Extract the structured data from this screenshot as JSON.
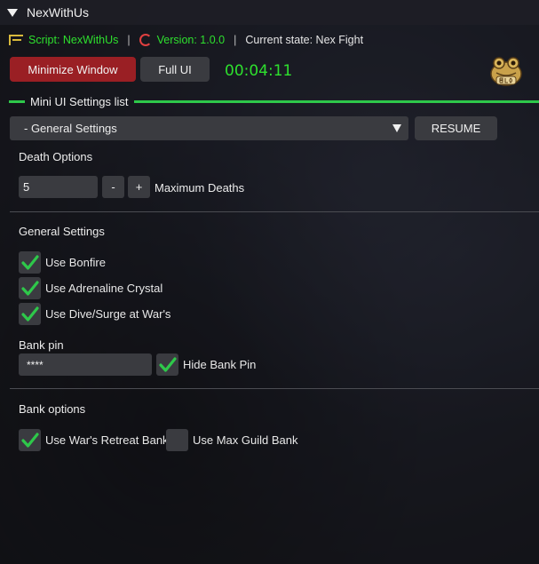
{
  "window": {
    "title": "NexWithUs"
  },
  "info": {
    "script_label": "Script: NexWithUs",
    "version_label": "Version: 1.0.0",
    "state_label": "Current state: Nex Fight",
    "separator": "|"
  },
  "buttons": {
    "minimize": "Minimize Window",
    "full_ui": "Full UI",
    "resume": "RESUME"
  },
  "timer": "00:04:11",
  "section": {
    "title": "Mini UI Settings list"
  },
  "dropdown": {
    "selected": "- General Settings"
  },
  "death_options": {
    "heading": "Death Options",
    "value": "5",
    "minus": "-",
    "plus": "+",
    "label": "Maximum Deaths"
  },
  "general_settings": {
    "heading": "General Settings",
    "items": [
      {
        "label": "Use Bonfire",
        "checked": true
      },
      {
        "label": "Use Adrenaline Crystal",
        "checked": true
      },
      {
        "label": "Use Dive/Surge at War's",
        "checked": true
      }
    ]
  },
  "bank_pin": {
    "heading": "Bank pin",
    "value": "****",
    "hide_label": "Hide Bank Pin",
    "hide_checked": true
  },
  "bank_options": {
    "heading": "Bank options",
    "items": [
      {
        "label": "Use War's Retreat Bank",
        "checked": true
      },
      {
        "label": "Use Max Guild Bank",
        "checked": false
      }
    ]
  },
  "colors": {
    "accent_green": "#2ee02e",
    "minimize_red": "#9a1f24",
    "panel": "#3a3b40"
  }
}
